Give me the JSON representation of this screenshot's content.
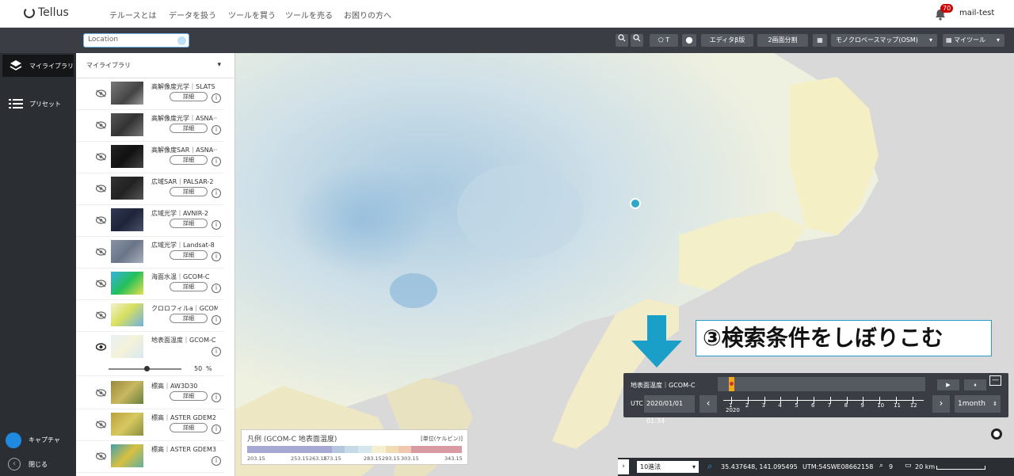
{
  "brand": {
    "name": "Tellus"
  },
  "nav": [
    "テルースとは",
    "データを扱う",
    "ツールを買う",
    "ツールを売る",
    "お困りの方へ"
  ],
  "header": {
    "notification_count": "70",
    "user": "mail-test"
  },
  "toolbar": {
    "search_placeholder": "Location",
    "editor_label": "エディタβ版",
    "split_label": "2画面分割",
    "basemap_label": "モノクロベースマップ(OSM)",
    "mytools_label": "マイツール"
  },
  "leftbar": {
    "library": "マイライブラリ",
    "preset": "プリセット",
    "capture": "キャプチャ",
    "close": "閉じる"
  },
  "panel": {
    "title": "マイライブラリ",
    "detail_label": "詳細",
    "items": [
      {
        "label": "高解像度光学｜SLATS"
      },
      {
        "label": "高解像度光学｜ASNA···"
      },
      {
        "label": "高解像度SAR｜ASNA···"
      },
      {
        "label": "広域SAR｜PALSAR-2"
      },
      {
        "label": "広域光学｜AVNIR-2"
      },
      {
        "label": "広域光学｜Landsat-8"
      },
      {
        "label": "海面水温｜GCOM-C"
      },
      {
        "label": "クロロフィルa｜GCOM-C"
      },
      {
        "label": "地表面温度｜GCOM-C"
      },
      {
        "label": "標高｜AW3D30"
      },
      {
        "label": "標高｜ASTER GDEM2"
      },
      {
        "label": "標高｜ASTER GDEM3"
      }
    ],
    "opacity_value": "50",
    "opacity_unit": "%"
  },
  "legend": {
    "title": "凡例 (GCOM-C 地表面温度)",
    "unit": "[単位(ケルビン)]",
    "ticks": [
      "203.15",
      "253.15",
      "263.15",
      "273.15",
      "283.15",
      "293.15",
      "303.15",
      "343.15"
    ]
  },
  "timeline": {
    "layer": "地表面温度｜GCOM-C",
    "utc_label": "UTC",
    "datetime": "2020/01/01 01:34",
    "months": [
      "1",
      "2",
      "3",
      "4",
      "5",
      "6",
      "7",
      "8",
      "9",
      "10",
      "11",
      "12"
    ],
    "year": "2020",
    "interval": "1month"
  },
  "callout": {
    "text": "③検索条件をしぼりこむ"
  },
  "status": {
    "format": "10進法",
    "coords": "35.437648, 141.095495",
    "utm": "UTM:54SWE08662158",
    "zoom": "9",
    "scale": "20 km"
  }
}
